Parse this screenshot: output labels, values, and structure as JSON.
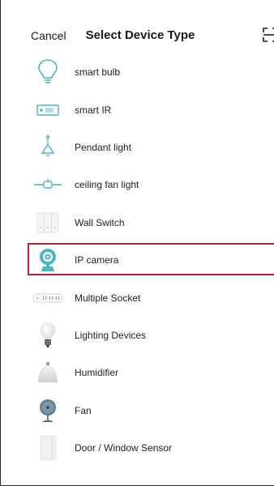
{
  "header": {
    "cancel_label": "Cancel",
    "title": "Select Device Type",
    "scan_icon": "scan-icon"
  },
  "devices": [
    {
      "label": "smart bulb",
      "icon": "bulb-outline-icon"
    },
    {
      "label": "smart IR",
      "icon": "ir-remote-icon"
    },
    {
      "label": "Pendant light",
      "icon": "pendant-light-icon"
    },
    {
      "label": "ceiling fan light",
      "icon": "ceiling-fan-light-icon"
    },
    {
      "label": "Wall Switch",
      "icon": "wall-switch-icon"
    },
    {
      "label": "IP camera",
      "icon": "ip-camera-icon",
      "highlighted": true
    },
    {
      "label": "Multiple Socket",
      "icon": "power-strip-icon"
    },
    {
      "label": "Lighting Devices",
      "icon": "lighting-bulb-icon"
    },
    {
      "label": "Humidifier",
      "icon": "humidifier-icon"
    },
    {
      "label": "Fan",
      "icon": "fan-icon"
    },
    {
      "label": "Door / Window Sensor",
      "icon": "door-sensor-icon"
    }
  ],
  "colors": {
    "accent_teal": "#4ab7c8",
    "highlight_border": "#b3282d"
  }
}
